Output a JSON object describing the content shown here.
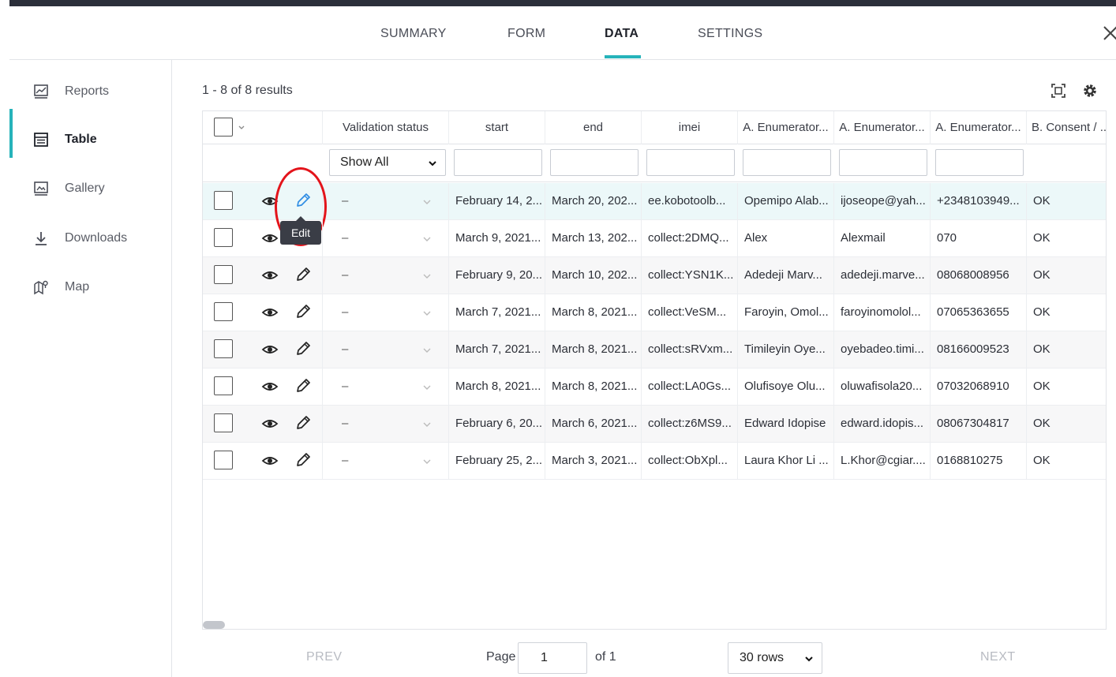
{
  "tabs": [
    {
      "label": "SUMMARY"
    },
    {
      "label": "FORM"
    },
    {
      "label": "DATA"
    },
    {
      "label": "SETTINGS"
    }
  ],
  "sidebar": {
    "items": [
      {
        "label": "Reports",
        "icon": "reports-icon"
      },
      {
        "label": "Table",
        "icon": "table-icon"
      },
      {
        "label": "Gallery",
        "icon": "gallery-icon"
      },
      {
        "label": "Downloads",
        "icon": "download-icon"
      },
      {
        "label": "Map",
        "icon": "map-icon"
      }
    ]
  },
  "main": {
    "results_text": "1 - 8 of 8 results",
    "accent_color": "#26b3ba"
  },
  "table": {
    "columns": [
      "Validation status",
      "start",
      "end",
      "imei",
      "A. Enumerator...",
      "A. Enumerator...",
      "A. Enumerator...",
      "B. Consent / ..."
    ],
    "validation_filter": "Show All",
    "tooltip": "Edit",
    "rows": [
      {
        "status": "–",
        "start": "February 14, 2...",
        "end": "March 20, 202...",
        "imei": "ee.kobotoolb...",
        "enum1": "Opemipo Alab...",
        "enum2": "ijoseope@yah...",
        "enum3": "+2348103949...",
        "consent": "OK"
      },
      {
        "status": "–",
        "start": "March 9, 2021...",
        "end": "March 13, 202...",
        "imei": "collect:2DMQ...",
        "enum1": "Alex",
        "enum2": "Alexmail",
        "enum3": "070",
        "consent": "OK"
      },
      {
        "status": "–",
        "start": "February 9, 20...",
        "end": "March 10, 202...",
        "imei": "collect:YSN1K...",
        "enum1": "Adedeji Marv...",
        "enum2": "adedeji.marve...",
        "enum3": "08068008956",
        "consent": "OK"
      },
      {
        "status": "–",
        "start": "March 7, 2021...",
        "end": "March 8, 2021...",
        "imei": "collect:VeSM...",
        "enum1": "Faroyin, Omol...",
        "enum2": "faroyinomolol...",
        "enum3": "07065363655",
        "consent": "OK"
      },
      {
        "status": "–",
        "start": "March 7, 2021...",
        "end": "March 8, 2021...",
        "imei": "collect:sRVxm...",
        "enum1": "Timileyin Oye...",
        "enum2": "oyebadeo.timi...",
        "enum3": "08166009523",
        "consent": "OK"
      },
      {
        "status": "–",
        "start": "March 8, 2021...",
        "end": "March 8, 2021...",
        "imei": "collect:LA0Gs...",
        "enum1": "Olufisoye Olu...",
        "enum2": "oluwafisola20...",
        "enum3": "07032068910",
        "consent": "OK"
      },
      {
        "status": "–",
        "start": "February 6, 20...",
        "end": "March 6, 2021...",
        "imei": "collect:z6MS9...",
        "enum1": "Edward Idopise",
        "enum2": "edward.idopis...",
        "enum3": "08067304817",
        "consent": "OK"
      },
      {
        "status": "–",
        "start": "February 25, 2...",
        "end": "March 3, 2021...",
        "imei": "collect:ObXpl...",
        "enum1": "Laura Khor Li ...",
        "enum2": "L.Khor@cgiar....",
        "enum3": "0168810275",
        "consent": "OK"
      }
    ]
  },
  "pagination": {
    "prev": "PREV",
    "next": "NEXT",
    "page_label": "Page",
    "page_value": "1",
    "of_label": "of 1",
    "rows_label": "30 rows"
  }
}
